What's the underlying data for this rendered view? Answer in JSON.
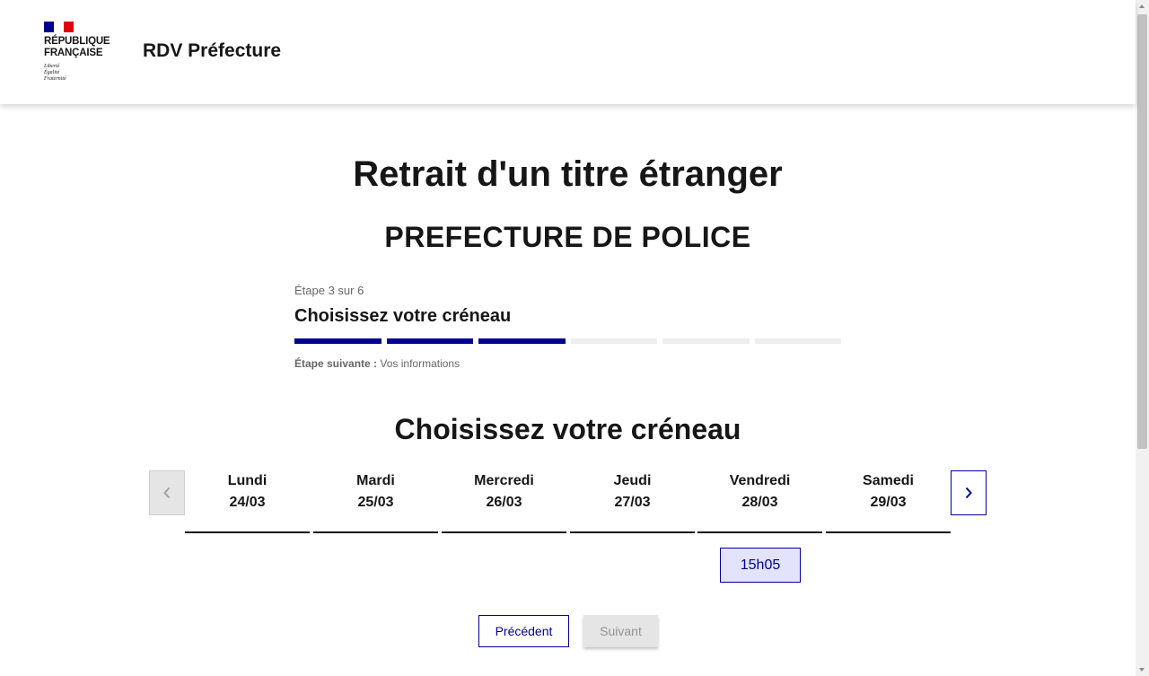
{
  "header": {
    "logo_line1": "RÉPUBLIQUE",
    "logo_line2": "FRANÇAISE",
    "motto": [
      "Liberté",
      "Égalité",
      "Fraternité"
    ],
    "service_title": "RDV Préfecture"
  },
  "colors": {
    "blue": "#000091",
    "red": "#e1000f",
    "white": "#ffffff",
    "slot_bg": "#e3e3fd"
  },
  "main": {
    "title": "Retrait d'un titre étranger",
    "subtitle": "PREFECTURE DE POLICE"
  },
  "stepper": {
    "state": "Étape 3 sur 6",
    "title": "Choisissez votre créneau",
    "current_step": 3,
    "total_steps": 6,
    "next_label": "Étape suivante :",
    "next_value": "Vos informations"
  },
  "calendar": {
    "title": "Choisissez votre créneau",
    "prev_icon": "chevron-left-icon",
    "next_icon": "chevron-right-icon",
    "days": [
      {
        "name": "Lundi",
        "date": "24/03"
      },
      {
        "name": "Mardi",
        "date": "25/03"
      },
      {
        "name": "Mercredi",
        "date": "26/03"
      },
      {
        "name": "Jeudi",
        "date": "27/03"
      },
      {
        "name": "Vendredi",
        "date": "28/03"
      },
      {
        "name": "Samedi",
        "date": "29/03"
      }
    ],
    "slots": [
      {
        "day": "Vendredi",
        "time": "15h05"
      }
    ]
  },
  "actions": {
    "previous": "Précédent",
    "next": "Suivant"
  }
}
